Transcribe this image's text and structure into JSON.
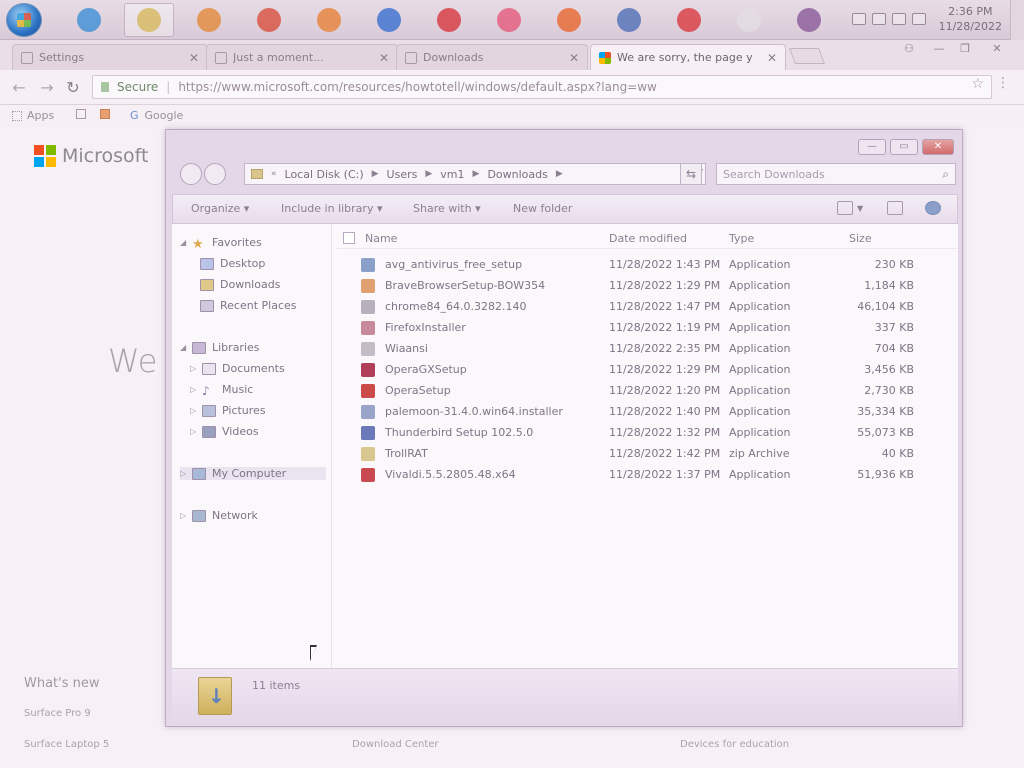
{
  "taskbar": {
    "apps": [
      {
        "name": "ie-icon",
        "color": "#3d8fd6"
      },
      {
        "name": "explorer-icon",
        "color": "#d6b65c",
        "active": true
      },
      {
        "name": "media-player-icon",
        "color": "#e48a3a"
      },
      {
        "name": "chrome-icon",
        "color": "#d9503f"
      },
      {
        "name": "firefox-icon",
        "color": "#e8813a"
      },
      {
        "name": "firefox-dev-icon",
        "color": "#3a6fd0"
      },
      {
        "name": "opera-icon",
        "color": "#d7373f"
      },
      {
        "name": "opera-gx-icon",
        "color": "#e35a7a"
      },
      {
        "name": "brave-icon",
        "color": "#e9662e"
      },
      {
        "name": "thunderbird-icon",
        "color": "#4f6fb7"
      },
      {
        "name": "vivaldi-icon",
        "color": "#d9393f"
      },
      {
        "name": "palemoon-icon",
        "color": "#e3dde4"
      },
      {
        "name": "winrar-icon",
        "color": "#8a5a9a"
      }
    ],
    "clock": {
      "time": "2:36 PM",
      "date": "11/28/2022"
    }
  },
  "browser": {
    "tabs": [
      {
        "title": "Settings",
        "icon": "gear-icon",
        "active": false
      },
      {
        "title": "Just a moment...",
        "icon": "page-icon",
        "active": false
      },
      {
        "title": "Downloads",
        "icon": "download-icon",
        "active": false
      },
      {
        "title": "We are sorry, the page y",
        "icon": "microsoft-icon",
        "active": true
      }
    ],
    "secure_label": "Secure",
    "url": "https://www.microsoft.com/resources/howtotell/windows/default.aspx?lang=ww",
    "bookmarks": {
      "apps": "Apps",
      "google": "Google"
    }
  },
  "webpage": {
    "brand": "Microsoft",
    "heading": "We",
    "whats_new": "What's new",
    "links": {
      "surface_pro": "Surface Pro 9",
      "surface_laptop": "Surface Laptop 5",
      "download_center": "Download Center",
      "devices_edu": "Devices for education"
    },
    "logo_colors": [
      "#f25022",
      "#7fba00",
      "#00a4ef",
      "#ffb900"
    ]
  },
  "explorer": {
    "breadcrumb": [
      "Local Disk (C:)",
      "Users",
      "vm1",
      "Downloads"
    ],
    "search_placeholder": "Search Downloads",
    "commands": {
      "organize": "Organize",
      "include_library": "Include in library",
      "share_with": "Share with",
      "new_folder": "New folder"
    },
    "nav": {
      "favorites": "Favorites",
      "desktop": "Desktop",
      "downloads": "Downloads",
      "recent": "Recent Places",
      "libraries": "Libraries",
      "documents": "Documents",
      "music": "Music",
      "pictures": "Pictures",
      "videos": "Videos",
      "computer": "My Computer",
      "network": "Network"
    },
    "columns": {
      "name": "Name",
      "date": "Date modified",
      "type": "Type",
      "size": "Size"
    },
    "files": [
      {
        "name": "avg_antivirus_free_setup",
        "date": "11/28/2022 1:43 PM",
        "type": "Application",
        "size": "230 KB",
        "color": "#8aa0c8"
      },
      {
        "name": "BraveBrowserSetup-BOW354",
        "date": "11/28/2022 1:29 PM",
        "type": "Application",
        "size": "1,184 KB",
        "color": "#e0a070"
      },
      {
        "name": "chrome84_64.0.3282.140",
        "date": "11/28/2022 1:47 PM",
        "type": "Application",
        "size": "46,104 KB",
        "color": "#b8b0bc"
      },
      {
        "name": "FirefoxInstaller",
        "date": "11/28/2022 1:19 PM",
        "type": "Application",
        "size": "337 KB",
        "color": "#c88a9a"
      },
      {
        "name": "Wiaansi",
        "date": "11/28/2022 2:35 PM",
        "type": "Application",
        "size": "704 KB",
        "color": "#c4bcc6"
      },
      {
        "name": "OperaGXSetup",
        "date": "11/28/2022 1:29 PM",
        "type": "Application",
        "size": "3,456 KB",
        "color": "#b0405a"
      },
      {
        "name": "OperaSetup",
        "date": "11/28/2022 1:20 PM",
        "type": "Application",
        "size": "2,730 KB",
        "color": "#cc4a4a"
      },
      {
        "name": "palemoon-31.4.0.win64.installer",
        "date": "11/28/2022 1:40 PM",
        "type": "Application",
        "size": "35,334 KB",
        "color": "#9aa4c8"
      },
      {
        "name": "Thunderbird Setup 102.5.0",
        "date": "11/28/2022 1:32 PM",
        "type": "Application",
        "size": "55,073 KB",
        "color": "#6a7ab8"
      },
      {
        "name": "TrollRAT",
        "date": "11/28/2022 1:42 PM",
        "type": "zip Archive",
        "size": "40 KB",
        "color": "#d8c890"
      },
      {
        "name": "Vivaldi.5.5.2805.48.x64",
        "date": "11/28/2022 1:37 PM",
        "type": "Application",
        "size": "51,936 KB",
        "color": "#c84a50"
      }
    ],
    "status": "11 items"
  }
}
